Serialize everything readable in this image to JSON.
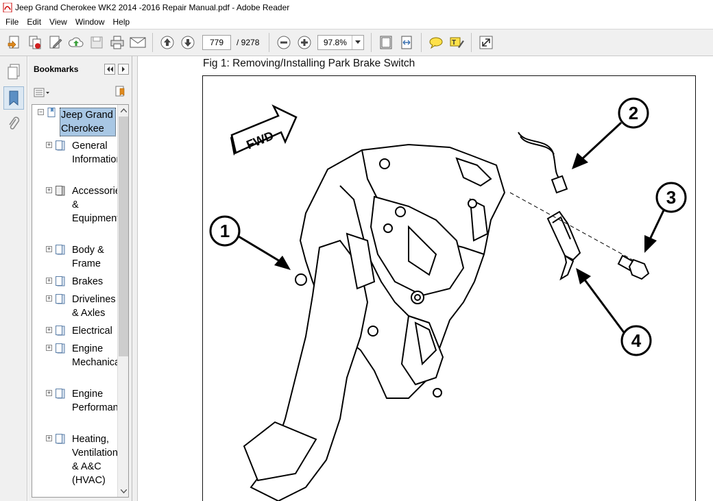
{
  "window": {
    "title": "Jeep Grand Cherokee WK2 2014 -2016 Repair Manual.pdf - Adobe Reader"
  },
  "menu": [
    "File",
    "Edit",
    "View",
    "Window",
    "Help"
  ],
  "toolbar": {
    "current_page": "779",
    "total_pages": "/ 9278",
    "zoom": "97.8%"
  },
  "bookmarks": {
    "title": "Bookmarks",
    "root": "Jeep Grand Cherokee",
    "items": [
      "General Information",
      "Accessories & Equipment",
      "Body & Frame",
      "Brakes",
      "Drivelines & Axles",
      "Electrical",
      "Engine Mechanical",
      "Engine Performance",
      "Heating, Ventilation & A&C (HVAC)"
    ]
  },
  "document": {
    "caption": "Fig 1: Removing/Installing Park Brake Switch",
    "fwd_label": "FWD",
    "callouts": [
      "1",
      "2",
      "3",
      "4"
    ]
  }
}
